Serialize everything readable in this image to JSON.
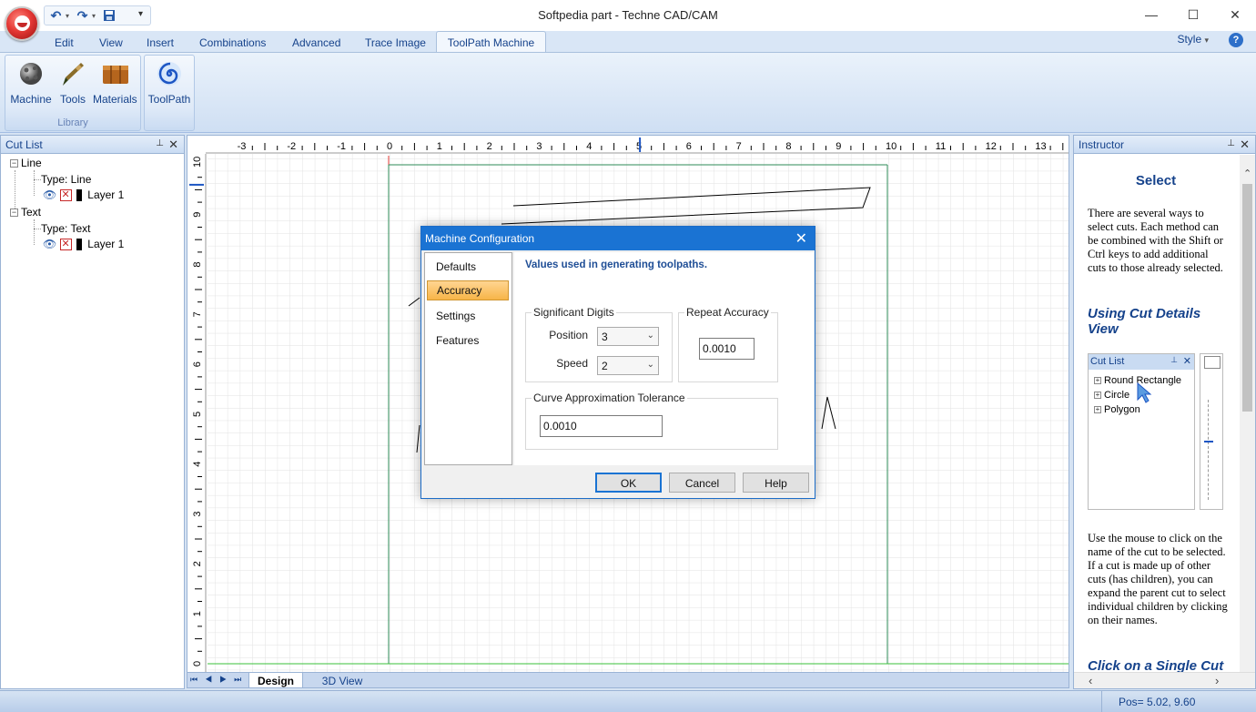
{
  "window": {
    "title": "Softpedia part - Techne CAD/CAM",
    "minimize": "—",
    "maximize": "☐",
    "close": "✕"
  },
  "quick_access": {
    "undo": "↶",
    "redo": "↷",
    "save": "💾",
    "customize": "▾"
  },
  "ribbon": {
    "tabs": [
      "Edit",
      "View",
      "Insert",
      "Combinations",
      "Advanced",
      "Trace Image",
      "ToolPath  Machine"
    ],
    "active_tab": "ToolPath  Machine",
    "style_label": "Style",
    "style_arrow": "▾",
    "help": "?",
    "groups": [
      {
        "label": "Library",
        "buttons": [
          "Machine",
          "Tools",
          "Materials"
        ]
      },
      {
        "label": "",
        "buttons": [
          "ToolPath"
        ]
      }
    ]
  },
  "cut_list": {
    "title": "Cut List",
    "pin": "📌",
    "close": "✕",
    "items": [
      {
        "name": "Line",
        "type_label": "Type: Line",
        "layer": "Layer 1"
      },
      {
        "name": "Text",
        "type_label": "Type: Text",
        "layer": "Layer 1"
      }
    ]
  },
  "ruler": {
    "top_labels": [
      "-3",
      "-2",
      "-1",
      "0",
      "1",
      "2",
      "3",
      "4",
      "5",
      "6",
      "7",
      "8",
      "9",
      "10",
      "11",
      "12",
      "13"
    ],
    "left_labels": [
      "10",
      "9",
      "8",
      "7",
      "6",
      "5",
      "4",
      "3",
      "2",
      "1",
      "0"
    ]
  },
  "canvas_tabs": {
    "nav": [
      "⏮",
      "◀",
      "▶",
      "⏭"
    ],
    "tabs": [
      "Design",
      "3D View"
    ],
    "active": "Design"
  },
  "instructor": {
    "title": "Instructor",
    "pin": "📌",
    "close": "✕",
    "heading": "Select",
    "p1": "There are several ways to select cuts. Each method can be combined with the Shift or Ctrl keys to add additional cuts to those already selected.",
    "h2": "Using Cut Details View",
    "mini_cut_list": {
      "title": "Cut List",
      "items": [
        "Round Rectangle",
        "Circle",
        "Polygon"
      ]
    },
    "p2": "Use the mouse to click on the name of the cut to be selected.  If a cut is made up of other cuts (has children), you can expand the parent cut to select individual children by clicking on their names.",
    "h3": "Click on a Single Cut"
  },
  "status": {
    "position": "Pos= 5.02, 9.60"
  },
  "dialog": {
    "title": "Machine Configuration",
    "close": "✕",
    "nav": [
      "Defaults",
      "Accuracy",
      "Settings",
      "Features"
    ],
    "selected_nav": "Accuracy",
    "heading": "Values used in generating toolpaths.",
    "significant_digits": {
      "title": "Significant Digits",
      "position_label": "Position",
      "position_value": "3",
      "speed_label": "Speed",
      "speed_value": "2"
    },
    "repeat_accuracy": {
      "title": "Repeat Accuracy",
      "value": "0.0010"
    },
    "curve_tolerance": {
      "title": "Curve Approximation Tolerance",
      "value": "0.0010"
    },
    "buttons": {
      "ok": "OK",
      "cancel": "Cancel",
      "help": "Help"
    }
  },
  "colors": {
    "accent": "#1a73d3",
    "ribbon_text": "#15428b",
    "selected_nav": "#f7b548"
  }
}
